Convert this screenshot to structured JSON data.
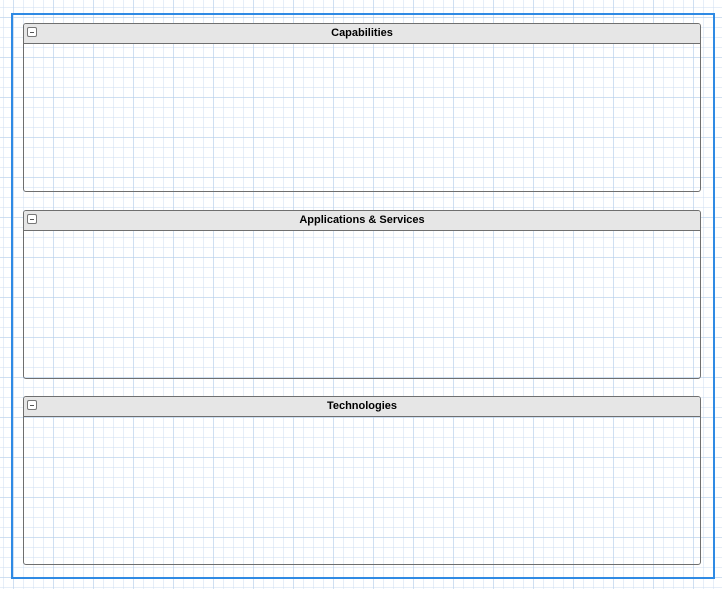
{
  "diagram": {
    "containers": [
      {
        "id": "capabilities",
        "title": "Capabilities",
        "collapse_icon": "minus-square-icon"
      },
      {
        "id": "applications-services",
        "title": "Applications & Services",
        "collapse_icon": "minus-square-icon"
      },
      {
        "id": "technologies",
        "title": "Technologies",
        "collapse_icon": "minus-square-icon"
      }
    ]
  },
  "colors": {
    "selection_border": "#2f8ae4",
    "header_fill": "#e6e6e6",
    "container_border": "#6f6f6f",
    "grid_line": "#cddef2"
  }
}
